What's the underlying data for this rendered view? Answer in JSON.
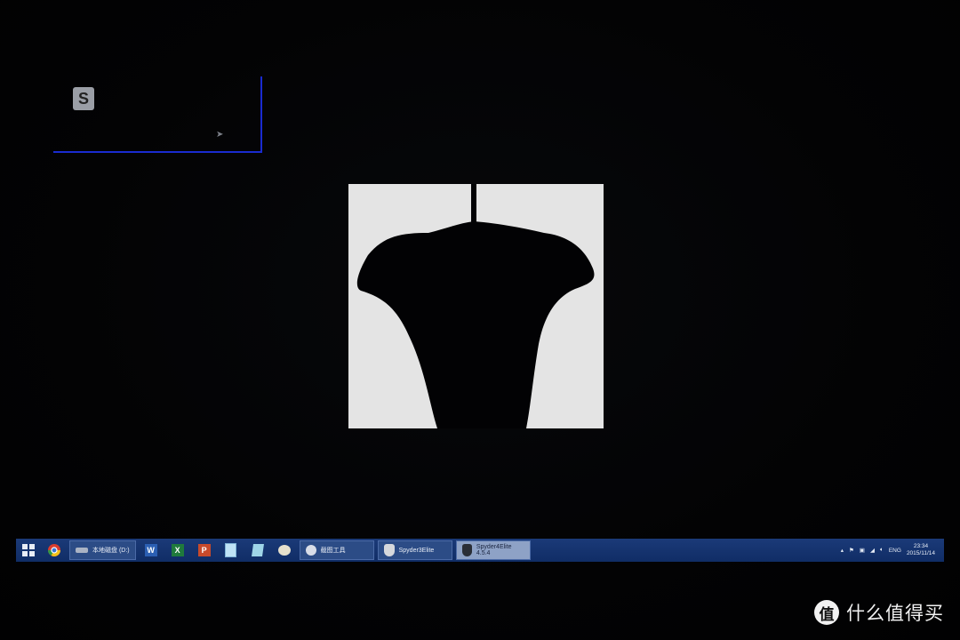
{
  "notification": {
    "icon": "spyder-s-icon",
    "text": "",
    "cursor": "arrow-cursor-icon"
  },
  "calibration": {
    "fill": "#e4e4e4",
    "shape_color": "#020204"
  },
  "taskbar": {
    "start_icon": "windows-start-icon",
    "pinned": [
      "chrome-icon"
    ],
    "buttons": [
      {
        "label": "本地磁盘 (D:)",
        "icon": "drive-icon",
        "active": false
      },
      {
        "label": "截图工具",
        "icon": "snipping-tool-icon",
        "active": false
      },
      {
        "label": "Spyder3Elite",
        "icon": "spyder3-icon",
        "active": false
      },
      {
        "label": "Spyder4Elite 4.5.4",
        "icon": "spyder4-icon",
        "active": true
      }
    ],
    "apps": [
      "word-icon",
      "excel-icon",
      "powerpoint-icon",
      "notepad-icon",
      "file-icon",
      "paint-icon"
    ],
    "tray": {
      "input_language": "ENG",
      "time": "23:34",
      "date": "2015/11/14"
    }
  },
  "watermark": {
    "logo": "值",
    "text": "什么值得买"
  }
}
